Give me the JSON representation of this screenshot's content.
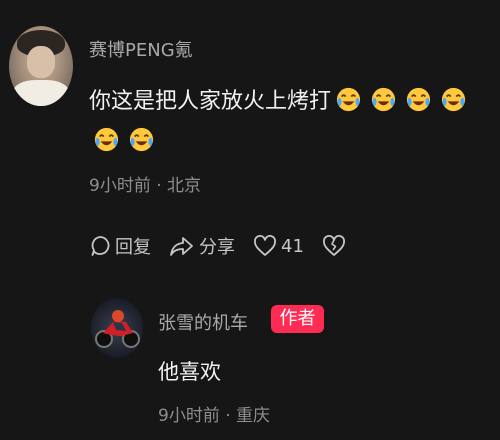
{
  "comment": {
    "username": "赛博PENG氪",
    "text": "你这是把人家放火上烤打",
    "emoji_icon": "crying-laughing-emoji",
    "emoji_count": 6,
    "meta": "9小时前 · 北京",
    "actions": {
      "reply_label": "回复",
      "share_label": "分享",
      "like_count": "41"
    }
  },
  "reply": {
    "username": "张雪的机车",
    "author_badge": "作者",
    "text": "他喜欢",
    "meta": "9小时前 · 重庆"
  },
  "colors": {
    "background": "#161616",
    "badge": "#fe2c55",
    "secondary_text": "#a9a9a9"
  }
}
